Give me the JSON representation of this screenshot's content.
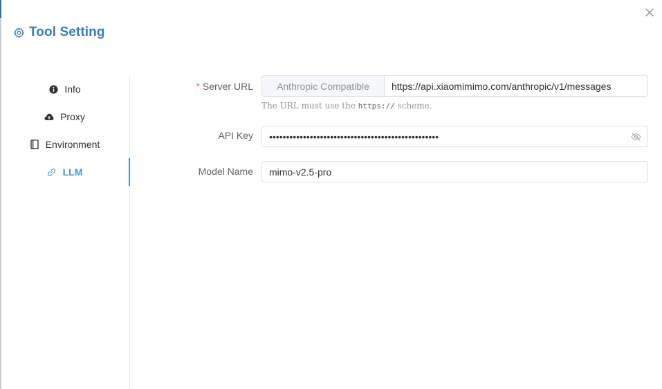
{
  "dialog": {
    "title": "Tool Setting"
  },
  "nav": {
    "items": [
      {
        "label": "Info",
        "icon": "info-circle-icon"
      },
      {
        "label": "Proxy",
        "icon": "cloud-upload-icon"
      },
      {
        "label": "Environment",
        "icon": "notebook-icon"
      },
      {
        "label": "LLM",
        "icon": "link-icon"
      }
    ],
    "active": "LLM"
  },
  "form": {
    "server_url": {
      "required_mark": "*",
      "label": "Server URL",
      "prefix": "Anthropic Compatible",
      "value": "https://api.xiaomimimo.com/anthropic/v1/messages",
      "hint_before": "The URL must use the ",
      "hint_code": "https://",
      "hint_after": " scheme."
    },
    "api_key": {
      "label": "API Key",
      "value": "••••••••••••••••••••••••••••••••••••••••••••••••••"
    },
    "model_name": {
      "label": "Model Name",
      "value": "mimo-v2.5-pro"
    }
  },
  "colors": {
    "accent": "#4a90d9",
    "title": "#3a7bc0",
    "required": "#f56c6c"
  }
}
